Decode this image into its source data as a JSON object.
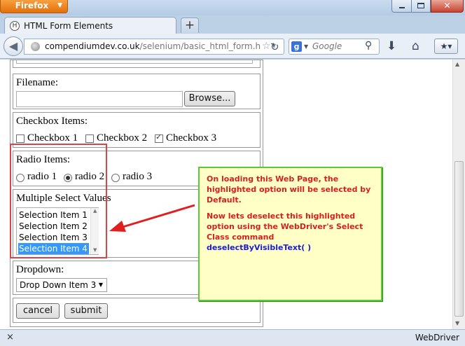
{
  "browser": {
    "menu_button": "Firefox",
    "tab_title": "HTML Form Elements",
    "tab_favicon_letter": "H",
    "new_tab": "+",
    "url_host": "compendiumdev.co.uk",
    "url_path": "/selenium/basic_html_form.h",
    "search_engine_letter": "g",
    "search_placeholder": "Google",
    "status_close": "×",
    "status_text": "WebDriver",
    "icons": [
      "back-icon",
      "site-icon",
      "star-icon",
      "reload-icon",
      "search-icon",
      "download-icon",
      "home-icon",
      "bookmarks-icon"
    ]
  },
  "form": {
    "filename_label": "Filename:",
    "browse_label": "Browse...",
    "checkbox_label": "Checkbox Items:",
    "checkboxes": [
      {
        "label": "Checkbox 1",
        "checked": false
      },
      {
        "label": "Checkbox 2",
        "checked": false
      },
      {
        "label": "Checkbox 3",
        "checked": true
      }
    ],
    "radio_label": "Radio Items:",
    "radios": [
      {
        "label": "radio 1",
        "checked": false
      },
      {
        "label": "radio 2",
        "checked": true
      },
      {
        "label": "radio 3",
        "checked": false
      }
    ],
    "multi_label": "Multiple Select Values",
    "multi_items": [
      {
        "label": "Selection Item 1",
        "selected": false
      },
      {
        "label": "Selection Item 2",
        "selected": false
      },
      {
        "label": "Selection Item 3",
        "selected": false
      },
      {
        "label": "Selection Item 4",
        "selected": true
      }
    ],
    "dropdown_label": "Dropdown:",
    "dropdown_value": "Drop Down Item 3",
    "cancel_label": "cancel",
    "submit_label": "submit"
  },
  "annotation": {
    "line1": "On loading this Web Page, the highlighted option will be selected by Default.",
    "line2": "Now lets deselect this highlighted option using the WebDriver's Select Class command",
    "command": "deselectByVisibleText( )",
    "colors": {
      "text": "#d52020",
      "command": "#1a1ad8",
      "border": "#59c935",
      "background": "#ffffc6",
      "arrow": "#e02020"
    }
  }
}
